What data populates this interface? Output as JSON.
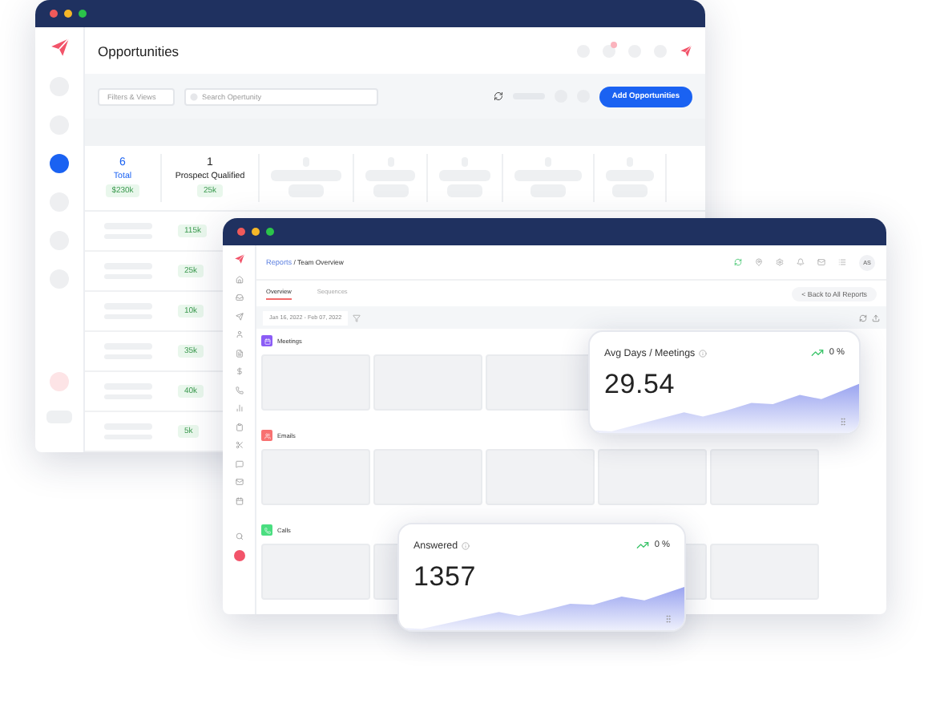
{
  "back_window": {
    "title": "Opportunities",
    "filter_button": "Filters & Views",
    "search": {
      "placeholder": "Search Opertunity"
    },
    "add_button": "Add Opportunities",
    "sidebar": [
      {
        "selected": false
      },
      {
        "selected": false
      },
      {
        "selected": true
      },
      {
        "selected": false
      },
      {
        "selected": false
      },
      {
        "selected": false
      }
    ],
    "stages": [
      {
        "kind": "total",
        "count": "6",
        "label": "Total",
        "amount": "$230k"
      },
      {
        "kind": "stage",
        "count": "1",
        "label": "Prospect Qualified",
        "amount": "25k"
      },
      {
        "kind": "blank"
      },
      {
        "kind": "blank"
      },
      {
        "kind": "blank"
      },
      {
        "kind": "blank"
      },
      {
        "kind": "blank"
      }
    ],
    "rows": [
      {
        "amount": "115k"
      },
      {
        "amount": "25k"
      },
      {
        "amount": "10k"
      },
      {
        "amount": "35k"
      },
      {
        "amount": "40k"
      },
      {
        "amount": "5k"
      }
    ]
  },
  "front_window": {
    "breadcrumb": {
      "section": "Reports",
      "page": "/ Team Overview"
    },
    "avatar": "AS",
    "tabs": [
      {
        "label": "Overview",
        "selected": true
      },
      {
        "label": "Sequences",
        "selected": false
      }
    ],
    "back_link": "< Back to All Reports",
    "date_range": "Jan 16, 2022 - Feb 07, 2022",
    "sections": [
      {
        "kind": "meetings",
        "title": "Meetings",
        "color": "#8b5cf6"
      },
      {
        "kind": "emails",
        "title": "Emails",
        "color": "#f87171"
      },
      {
        "kind": "calls",
        "title": "Calls",
        "color": "#4ade80"
      }
    ]
  },
  "cards": [
    {
      "title": "Avg Days / Meetings",
      "value": "29.54",
      "change": "0 %"
    },
    {
      "title": "Answered",
      "value": "1357",
      "change": "0 %"
    }
  ]
}
